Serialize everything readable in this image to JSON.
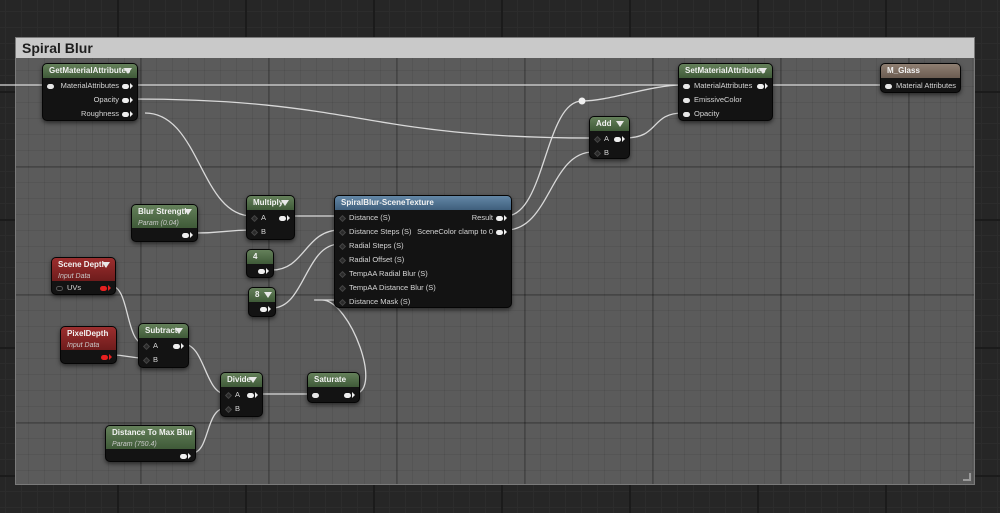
{
  "comment": {
    "title": "Spiral Blur"
  },
  "colors": {
    "background": "#262626",
    "comment_box": "#5b5b5b",
    "comment_header": "#c9c9c9",
    "node_body": "#131313",
    "header_green": "#4f6d46",
    "header_blue": "#4f7190",
    "header_tan": "#7c6d61",
    "header_red": "#8a2424",
    "wire": "#d9d9d9",
    "red_pin": "#e62020"
  },
  "nodes": {
    "get_material_attributes": {
      "title": "GetMaterialAttributes",
      "outputs": [
        "MaterialAttributes",
        "Opacity",
        "Roughness"
      ]
    },
    "set_material_attributes": {
      "title": "SetMaterialAttributes",
      "inputs": [
        "MaterialAttributes",
        "EmissiveColor",
        "Opacity"
      ]
    },
    "m_glass": {
      "title": "M_Glass",
      "inputs": [
        "Material Attributes"
      ]
    },
    "add": {
      "title": "Add",
      "inputs": [
        "A",
        "B"
      ]
    },
    "multiply": {
      "title": "Multiply",
      "inputs": [
        "A",
        "B"
      ]
    },
    "blur_strength": {
      "title": "Blur Strength",
      "subtitle": "Param (0.04)"
    },
    "const_4": {
      "title": "4"
    },
    "const_8": {
      "title": "8"
    },
    "spiral_blur": {
      "title": "SpiralBlur-SceneTexture",
      "inputs": [
        "Distance (S)",
        "Distance Steps (S)",
        "Radial Steps (S)",
        "Radial Offset (S)",
        "TempAA Radial Blur (S)",
        "TempAA Distance Blur (S)",
        "Distance Mask (S)"
      ],
      "outputs": [
        "Result",
        "SceneColor clamp to 0"
      ]
    },
    "scene_depth": {
      "title": "Scene Depth",
      "subtitle": "Input Data",
      "inputs": [
        "UVs"
      ]
    },
    "pixel_depth": {
      "title": "PixelDepth",
      "subtitle": "Input Data"
    },
    "subtract": {
      "title": "Subtract",
      "inputs": [
        "A",
        "B"
      ]
    },
    "divide": {
      "title": "Divide",
      "inputs": [
        "A",
        "B"
      ]
    },
    "saturate": {
      "title": "Saturate"
    },
    "distance_to_max_blur": {
      "title": "Distance To Max Blur",
      "subtitle": "Param (750.4)"
    }
  }
}
